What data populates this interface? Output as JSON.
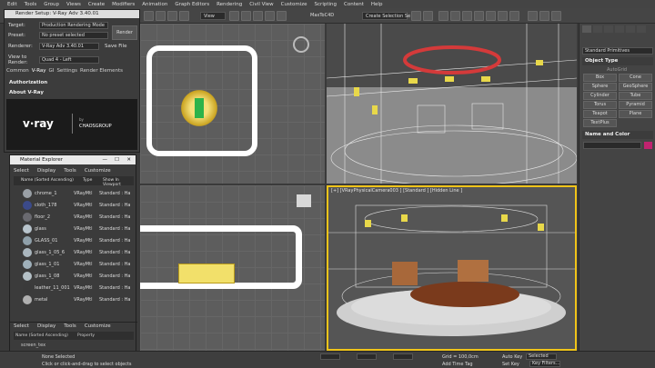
{
  "menubar": {
    "items": [
      "Edit",
      "Tools",
      "Group",
      "Views",
      "Create",
      "Modifiers",
      "Animation",
      "Graph Editors",
      "Rendering",
      "Civil View",
      "Customize",
      "Scripting",
      "Content",
      "Help"
    ]
  },
  "toolbar": {
    "view_dropdown": "View",
    "selection_set": "Create Selection Se",
    "maxtoc": "MaxToC4D"
  },
  "viewports": {
    "top_left_label": "",
    "top_right_label": "",
    "bottom_left_label": "",
    "bottom_right_label": "[+] [VRayPhysicalCamera003 ] [Standard ] [Hidden Line ]"
  },
  "command_panel": {
    "dropdown": "Standard Primitives",
    "object_type_title": "Object Type",
    "autogrid": "AutoGrid",
    "buttons": [
      "Box",
      "Cone",
      "Sphere",
      "GeoSphere",
      "Cylinder",
      "Tube",
      "Torus",
      "Pyramid",
      "Teapot",
      "Plane",
      "TextPlus"
    ],
    "name_color_title": "Name and Color",
    "accent_color": "#c0236f"
  },
  "render_setup": {
    "title": "Render Setup: V-Ray Adv 3.40.01",
    "target_label": "Target:",
    "target_value": "Production Rendering Mode",
    "preset_label": "Preset:",
    "preset_value": "No preset selected",
    "renderer_label": "Renderer:",
    "renderer_value": "V-Ray Adv 3.40.01",
    "save_file": "Save File",
    "view_label": "View to Render:",
    "view_value": "Quad 4 - Left",
    "render_button": "Render",
    "tabs": [
      "Common",
      "V-Ray",
      "GI",
      "Settings",
      "Render Elements"
    ],
    "rollout_auth": "Authorization",
    "rollout_about": "About V-Ray",
    "vray_logo": "v·ray",
    "chaos_logo": "CHAOSGROUP",
    "chaos_by": "by"
  },
  "material_explorer": {
    "title": "Material Explorer",
    "menu": [
      "Select",
      "Display",
      "Tools",
      "Customize"
    ],
    "header": [
      "Name (Sorted Ascending)",
      "Type",
      "Show In Viewport"
    ],
    "rows": [
      {
        "name": "chrome_1",
        "type": "VRayMtl",
        "show": "Standard : Ha",
        "color": "#9aa0a6"
      },
      {
        "name": "cloth_178",
        "type": "VRayMtl",
        "show": "Standard : Ha",
        "color": "#3b4a8a"
      },
      {
        "name": "floor_2",
        "type": "VRayMtl",
        "show": "Standard : Ha",
        "color": "#6a6a70"
      },
      {
        "name": "glass",
        "type": "VRayMtl",
        "show": "Standard : Ha",
        "color": "#b8c4cc"
      },
      {
        "name": "GLASS_01",
        "type": "VRayMtl",
        "show": "Standard : Ha",
        "color": "#8fa0aa"
      },
      {
        "name": "glass_1_05_6",
        "type": "VRayMtl",
        "show": "Standard : Ha",
        "color": "#aab6be"
      },
      {
        "name": "glass_1_01",
        "type": "VRayMtl",
        "show": "Standard : Ha",
        "color": "#9fb0ba"
      },
      {
        "name": "glass_1_08",
        "type": "VRayMtl",
        "show": "Standard : Ha",
        "color": "#b4c0c6"
      },
      {
        "name": "leather_11_001",
        "type": "VRayMtl",
        "show": "Standard : Ha",
        "color": "#3a3a3a"
      },
      {
        "name": "metal",
        "type": "VRayMtl",
        "show": "Standard : Ha",
        "color": "#b0b0b0"
      }
    ],
    "menu2": [
      "Select",
      "Display",
      "Tools",
      "Customize"
    ],
    "header2": [
      "Name (Sorted Ascending)",
      "Property"
    ],
    "rows2": [
      "screen_tex"
    ]
  },
  "statusbar": {
    "selection": "None Selected",
    "hint": "Click or click-and-drag to select objects",
    "grid": "Grid = 100,0cm",
    "add_time_tag": "Add Time Tag",
    "auto_key": "Auto Key",
    "set_key": "Set Key",
    "selected": "Selected",
    "key_filters": "Key Filters..."
  }
}
